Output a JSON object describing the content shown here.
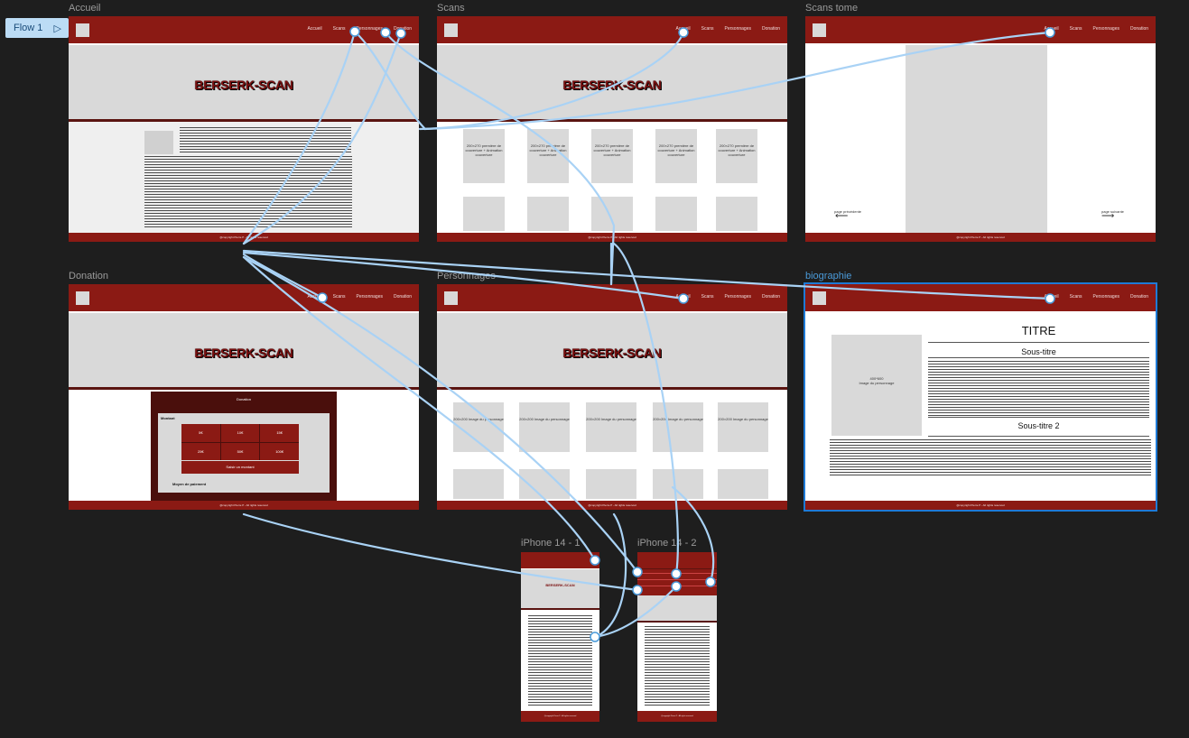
{
  "flow": {
    "label": "Flow 1",
    "icon": "play-icon"
  },
  "brand": "BERSERK-SCAN",
  "footer_copy": "@copyright Pierre P - All rights reserved",
  "nav": [
    "Accueil",
    "Scans",
    "Personnages",
    "Donation"
  ],
  "frames": {
    "accueil": {
      "title": "Accueil"
    },
    "scans": {
      "title": "Scans"
    },
    "scans_tome": {
      "title": "Scans tome",
      "prev": "page précédente",
      "next": "page suivante"
    },
    "donation": {
      "title": "Donation",
      "panel_title": "Donation",
      "montant": "Montant",
      "amounts": [
        "5€",
        "10€",
        "15€",
        "25€",
        "50€",
        "100€"
      ],
      "custom": "Saisir un montant",
      "payment": "Moyen de paiement"
    },
    "personnages": {
      "title": "Personnages"
    },
    "biographie": {
      "title": "biographie",
      "heading": "TITRE",
      "sub1": "Sous-titre",
      "sub2": "Sous-titre 2",
      "image_label": "400*600\nImage du personnage"
    },
    "iphone1": {
      "title": "iPhone 14 - 1"
    },
    "iphone2": {
      "title": "iPhone 14 - 2"
    }
  },
  "scan_card_label": "200×270 première de couverture + Animation couverture",
  "perso_card_label": "200×200 Image du personnage",
  "colors": {
    "bg": "#1e1e1e",
    "header": "#8b1a14",
    "hero": "#d9d9d9",
    "connector": "#a9d2f5",
    "selected": "#1e7ad6"
  }
}
